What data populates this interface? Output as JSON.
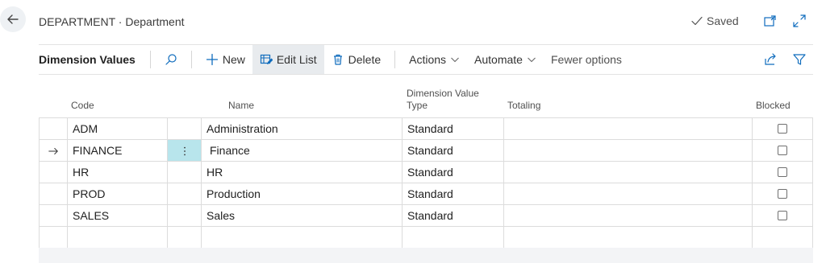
{
  "header": {
    "title": "DEPARTMENT · Department",
    "saved_label": "Saved"
  },
  "toolbar": {
    "title": "Dimension Values",
    "new_label": "New",
    "edit_list_label": "Edit List",
    "delete_label": "Delete",
    "actions_label": "Actions",
    "automate_label": "Automate",
    "fewer_options_label": "Fewer options"
  },
  "columns": {
    "code": "Code",
    "name": "Name",
    "type_line1": "Dimension Value",
    "type_line2": "Type",
    "totaling": "Totaling",
    "blocked": "Blocked"
  },
  "rows": [
    {
      "code": "ADM",
      "name": "Administration",
      "type": "Standard",
      "totaling": "",
      "blocked": false
    },
    {
      "code": "FINANCE",
      "name": "Finance",
      "type": "Standard",
      "totaling": "",
      "blocked": false,
      "selected": true
    },
    {
      "code": "HR",
      "name": "HR",
      "type": "Standard",
      "totaling": "",
      "blocked": false
    },
    {
      "code": "PROD",
      "name": "Production",
      "type": "Standard",
      "totaling": "",
      "blocked": false
    },
    {
      "code": "SALES",
      "name": "Sales",
      "type": "Standard",
      "totaling": "",
      "blocked": false
    },
    {
      "code": "",
      "name": "",
      "type": "",
      "totaling": "",
      "blocked": null
    }
  ],
  "icons": {
    "back": "back-arrow-icon",
    "saved": "checkmark-icon",
    "open_new_window": "open-in-new-window-icon",
    "expand": "expand-icon",
    "search": "search-icon",
    "new": "plus-icon",
    "edit_list": "edit-list-icon",
    "delete": "trash-icon",
    "share": "share-icon",
    "filter": "filter-icon",
    "row_menu": "vertical-ellipsis-icon",
    "row_arrow": "row-pointer-arrow-icon"
  },
  "colors": {
    "accent": "#0f6cbd",
    "selected_cell": "#b8e5ec",
    "active_button": "#e8ebee"
  }
}
